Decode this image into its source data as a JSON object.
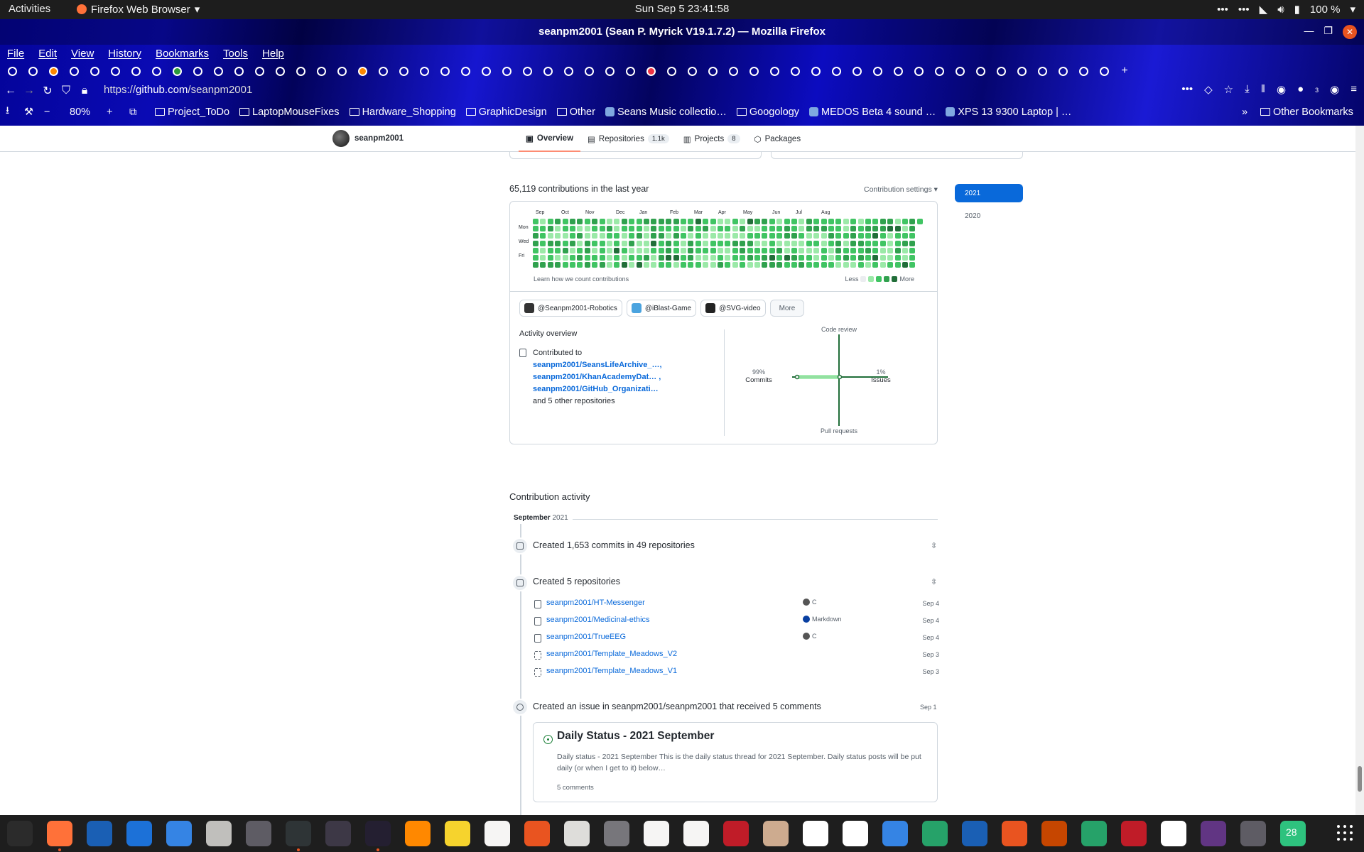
{
  "system": {
    "activities": "Activities",
    "app_name": "Firefox Web Browser",
    "clock": "Sun Sep 5  23:41:58",
    "battery": "100 %"
  },
  "window": {
    "title": "seanpm2001 (Sean P. Myrick V19.1.7.2) — Mozilla Firefox"
  },
  "menu": [
    "File",
    "Edit",
    "View",
    "History",
    "Bookmarks",
    "Tools",
    "Help"
  ],
  "toolbar": {
    "url_prefix": "https://",
    "url_host": "github.com",
    "url_path": "/seanpm2001",
    "zoom": "80%",
    "notif_count": "3"
  },
  "bookmarks": [
    {
      "label": "Project_ToDo",
      "icon": "folder"
    },
    {
      "label": "LaptopMouseFixes",
      "icon": "folder"
    },
    {
      "label": "Hardware_Shopping",
      "icon": "folder"
    },
    {
      "label": "GraphicDesign",
      "icon": "folder"
    },
    {
      "label": "Other",
      "icon": "folder"
    },
    {
      "label": "Seans Music collectio…",
      "icon": "favicon"
    },
    {
      "label": "Googology",
      "icon": "folder"
    },
    {
      "label": "MEDOS Beta 4 sound …",
      "icon": "favicon"
    },
    {
      "label": "XPS 13 9300 Laptop | …",
      "icon": "favicon"
    }
  ],
  "other_bookmarks": "Other Bookmarks",
  "profile_header": {
    "username": "seanpm2001",
    "tabs": [
      {
        "label": "Overview",
        "count": ""
      },
      {
        "label": "Repositories",
        "count": "1.1k"
      },
      {
        "label": "Projects",
        "count": "8"
      },
      {
        "label": "Packages",
        "count": ""
      }
    ]
  },
  "contributions": {
    "title": "65,119 contributions in the last year",
    "settings": "Contribution settings ▾",
    "months": [
      "Sep",
      "Oct",
      "Nov",
      "Dec",
      "Jan",
      "Feb",
      "Mar",
      "Apr",
      "May",
      "Jun",
      "Jul",
      "Aug"
    ],
    "days": [
      "Mon",
      "Wed",
      "Fri"
    ],
    "learn": "Learn how we count contributions",
    "less": "Less",
    "more": "More",
    "colors": [
      "#ebedf0",
      "#9be9a8",
      "#40c463",
      "#30a14e",
      "#216e39"
    ]
  },
  "years": [
    "2021",
    "2020"
  ],
  "orgs": [
    {
      "label": "@Seanpm2001-Robotics",
      "color": "#333"
    },
    {
      "label": "@iBlast-Game",
      "color": "#4aa3df"
    },
    {
      "label": "@SVG-video",
      "color": "#222"
    }
  ],
  "more_button": "More",
  "activity_overview": {
    "title": "Activity overview",
    "contributed_to": "Contributed to",
    "repos": [
      "seanpm2001/SeansLifeArchive_…,",
      "seanpm2001/KhanAcademyDat… ,",
      "seanpm2001/GitHub_Organizati…"
    ],
    "others": "and 5 other repositories",
    "graph": {
      "code_review": "Code review",
      "commits_pct": "99%",
      "commits": "Commits",
      "issues_pct": "1%",
      "issues": "Issues",
      "pull_requests": "Pull requests"
    }
  },
  "activity": {
    "title": "Contribution activity",
    "month": "September",
    "year": "2021",
    "commits": "Created 1,653 commits in 49 repositories",
    "created_repos": "Created 5 repositories",
    "repos": [
      {
        "name": "seanpm2001/HT-Messenger",
        "lang": "C",
        "color": "#555555",
        "date": "Sep 4",
        "template": false
      },
      {
        "name": "seanpm2001/Medicinal-ethics",
        "lang": "Markdown",
        "color": "#083fa1",
        "date": "Sep 4",
        "template": false
      },
      {
        "name": "seanpm2001/TrueEEG",
        "lang": "C",
        "color": "#555555",
        "date": "Sep 4",
        "template": false
      },
      {
        "name": "seanpm2001/Template_Meadows_V2",
        "lang": "",
        "color": "",
        "date": "Sep 3",
        "template": true
      },
      {
        "name": "seanpm2001/Template_Meadows_V1",
        "lang": "",
        "color": "",
        "date": "Sep 3",
        "template": true
      }
    ],
    "issue_event": "Created an issue in seanpm2001/seanpm2001 that received 5 comments",
    "issue_date": "Sep 1",
    "issue": {
      "title": "Daily Status - 2021 September",
      "body": "Daily status - 2021 September This is the daily status thread for 2021 September. Daily status posts will be put daily (or when I get to it) below…",
      "comments": "5 comments"
    }
  },
  "dock_badge": "28"
}
